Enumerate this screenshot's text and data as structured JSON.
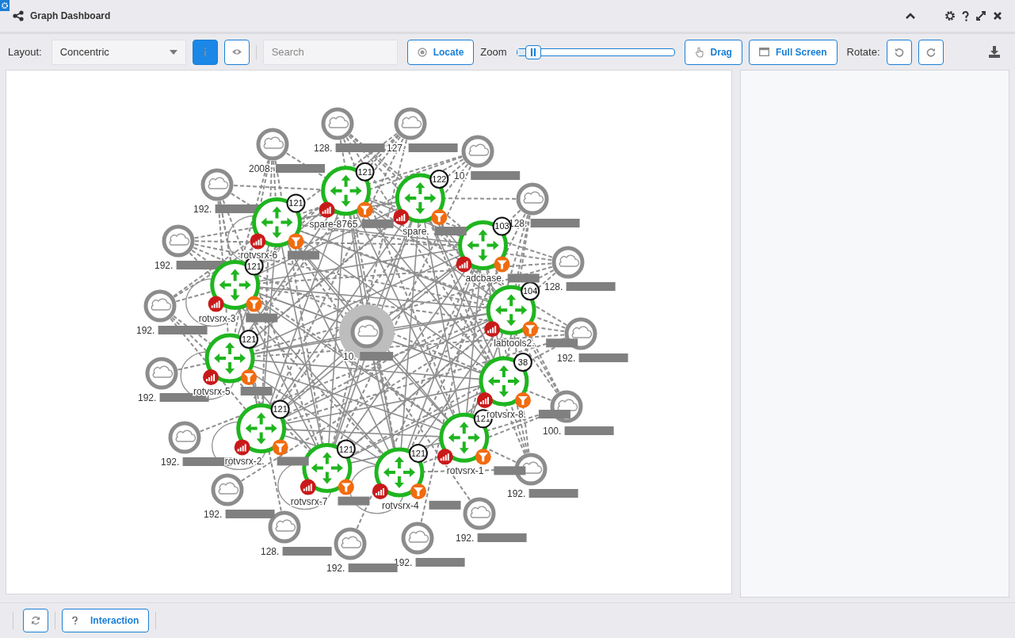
{
  "window": {
    "title": "Graph Dashboard"
  },
  "toolbar": {
    "layout_label": "Layout:",
    "layout_value": "Concentric",
    "info_button": {
      "selected": true
    },
    "eye_button": {
      "selected": false
    },
    "search": {
      "placeholder": "Search"
    },
    "locate": "Locate",
    "zoom_label": "Zoom",
    "zoom": {
      "level": 0.1
    },
    "drag": "Drag",
    "full_screen": "Full Screen",
    "rotate_label": "Rotate:"
  },
  "graph": {
    "center": {
      "label": "10."
    },
    "routers": [
      {
        "label": "spare-8765",
        "badge": "121"
      },
      {
        "label": "spare.",
        "badge": "122"
      },
      {
        "label": "rotvsrx-6",
        "badge": "121"
      },
      {
        "label": "adcbase.",
        "badge": "103"
      },
      {
        "label": "rotvsrx-3",
        "badge": "121"
      },
      {
        "label": "labtools2.",
        "badge": "104"
      },
      {
        "label": "rotvsrx-5",
        "badge": "121"
      },
      {
        "label": "rotvsrx-8.",
        "badge": "38"
      },
      {
        "label": "rotvsrx-2.",
        "badge": "121"
      },
      {
        "label": "rotvsrx-1",
        "badge": "121"
      },
      {
        "label": "rotvsrx-7",
        "badge": "121"
      },
      {
        "label": "rotvsrx-4",
        "badge": "121"
      }
    ],
    "clouds": [
      {
        "label": "128."
      },
      {
        "label": "127."
      },
      {
        "label": "10."
      },
      {
        "label": "128."
      },
      {
        "label": "128."
      },
      {
        "label": "192."
      },
      {
        "label": "100."
      },
      {
        "label": "192."
      },
      {
        "label": "192."
      },
      {
        "label": "192."
      },
      {
        "label": "192."
      },
      {
        "label": "128."
      },
      {
        "label": "192."
      },
      {
        "label": "192."
      },
      {
        "label": "192."
      },
      {
        "label": "192."
      },
      {
        "label": "192."
      },
      {
        "label": "192."
      },
      {
        "label": "2008."
      }
    ]
  },
  "footer": {
    "interaction": "Interaction"
  }
}
